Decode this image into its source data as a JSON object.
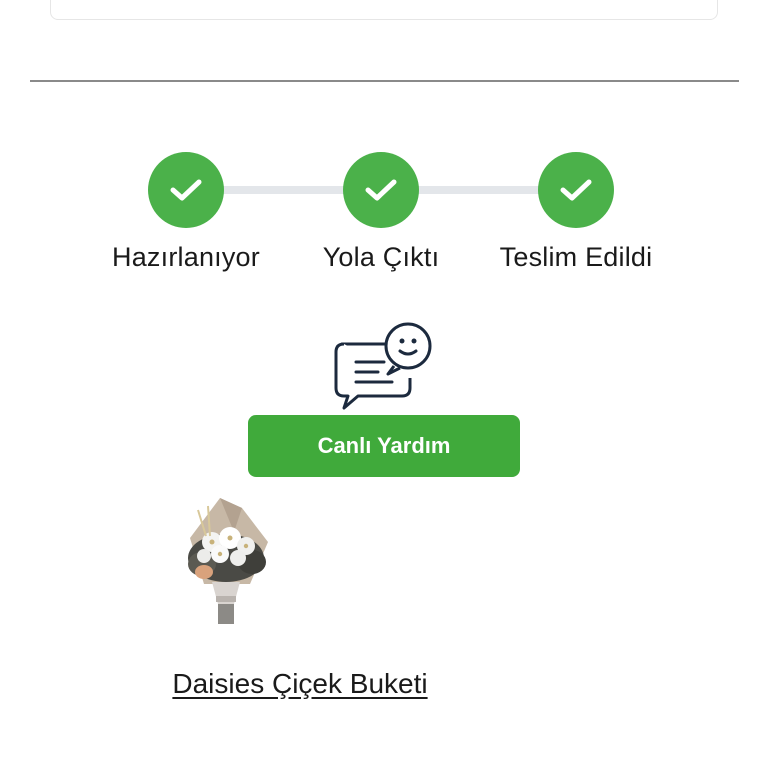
{
  "tracking": {
    "steps": [
      {
        "label": "Hazırlanıyor",
        "status": "completed"
      },
      {
        "label": "Yola Çıktı",
        "status": "completed"
      },
      {
        "label": "Teslim Edildi",
        "status": "completed"
      }
    ],
    "step_icon": "checkmark-icon",
    "accent_color": "#4bb14a"
  },
  "support": {
    "icon": "chat-bubble-smile-icon",
    "button_label": "Canlı Yardım",
    "button_color": "#40aa3b"
  },
  "product": {
    "image_icon": "flower-bouquet-image",
    "name": "Daisies Çiçek Buketi"
  }
}
